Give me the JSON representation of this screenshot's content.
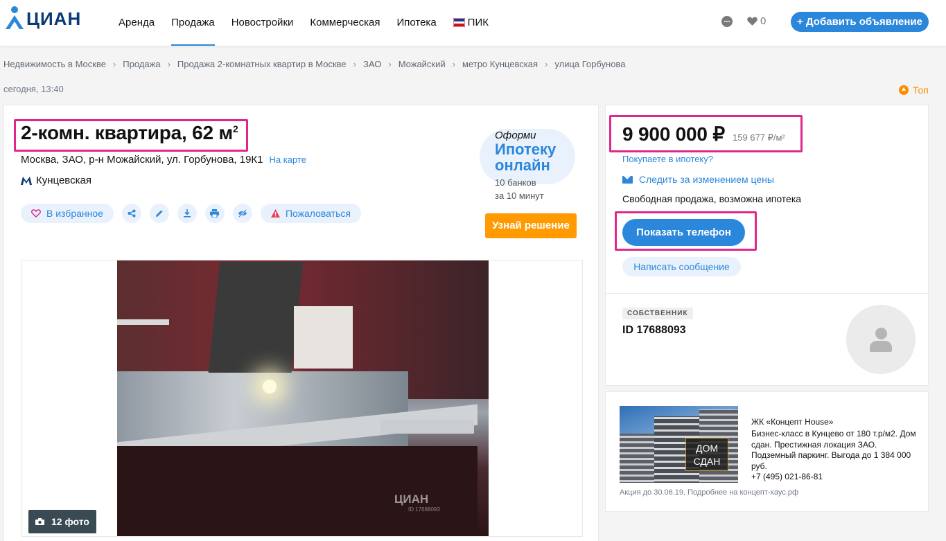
{
  "header": {
    "logo_text": "ЦИАН",
    "nav": [
      {
        "label": "Аренда",
        "active": false
      },
      {
        "label": "Продажа",
        "active": true
      },
      {
        "label": "Новостройки",
        "active": false
      },
      {
        "label": "Коммерческая",
        "active": false
      },
      {
        "label": "Ипотека",
        "active": false
      },
      {
        "label": "ПИК",
        "active": false
      }
    ],
    "favorites_count": "0",
    "add_button": "+ Добавить объявление"
  },
  "breadcrumbs": [
    "Недвижимость в Москве",
    "Продажа",
    "Продажа 2-комнатных квартир в Москве",
    "ЗАО",
    "Можайский",
    "метро Кунцевская",
    "улица Горбунова"
  ],
  "published": "сегодня, 13:40",
  "top_label": "Топ",
  "listing": {
    "title": "2-комн. квартира, 62 м",
    "title_sup": "2",
    "address": "Москва, ЗАО, р-н Можайский, ул. Горбунова, 19К1",
    "map_link": "На карте",
    "metro": "Кунцевская",
    "favorite_label": "В избранное",
    "report_label": "Пожаловаться",
    "photo_count": "12 фото",
    "watermark": "ЦИАН",
    "watermark_id": "ID 17688093"
  },
  "mortgage_promo": {
    "pre": "Оформи",
    "main_line1": "Ипотеку",
    "main_line2": "онлайн",
    "sub_line1": "10 банков",
    "sub_line2": "за 10 минут",
    "button": "Узнай решение"
  },
  "price_block": {
    "price": "9 900 000 ₽",
    "price_per_m2": "159 677 ₽/м²",
    "mortgage_link": "Покупаете в ипотеку?",
    "watch_price": "Следить за изменением цены",
    "sale_type": "Свободная продажа, возможна ипотека",
    "phone_button": "Показать телефон",
    "message_button": "Написать сообщение"
  },
  "owner": {
    "badge": "СОБСТВЕННИК",
    "id": "ID 17688093"
  },
  "ad": {
    "sign_line1": "ДОМ",
    "sign_line2": "СДАН",
    "title": "ЖК «Концепт House»",
    "text": "Бизнес-класс в Кунцево от 180 т.р/м2. Дом сдан. Престижная локация ЗАО. Подземный паркинг. Выгода до 1 384 000 руб.",
    "phone": "+7 (495) 021-86-81",
    "footer": "Акция до 30.06.19. Подробнее на концепт-хаус.рф"
  },
  "colors": {
    "accent": "#2b87db",
    "highlight": "#e0288c",
    "cta_orange": "#ff9a00"
  }
}
